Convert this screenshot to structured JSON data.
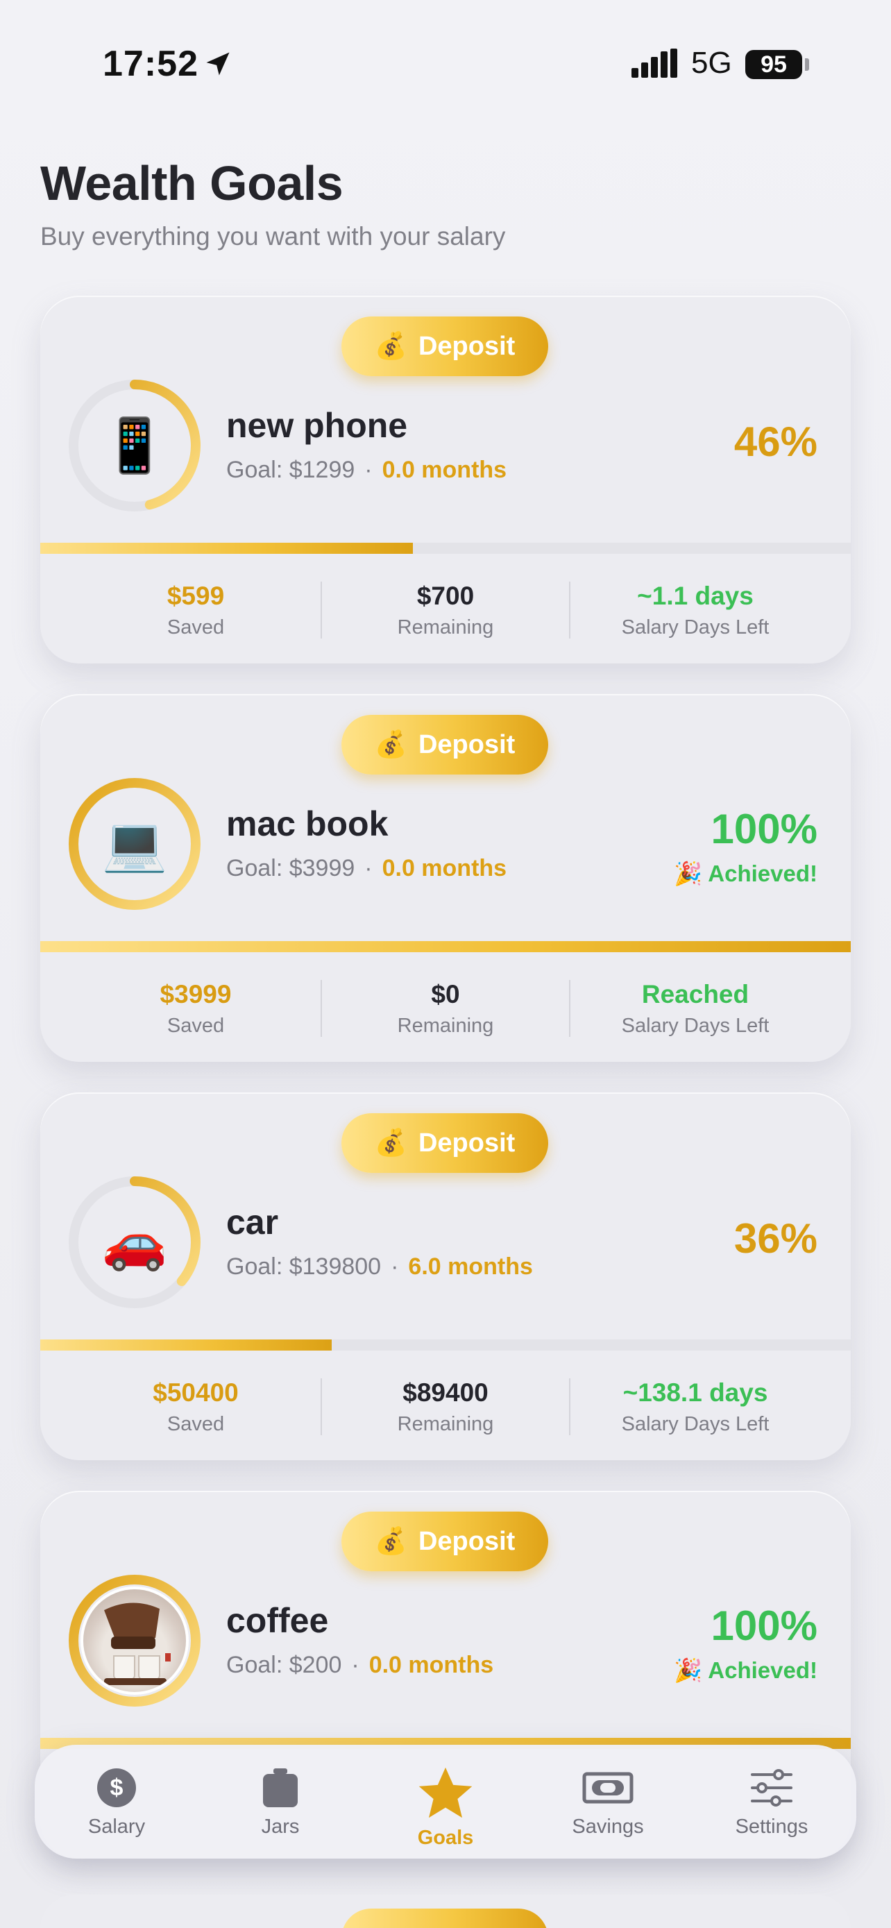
{
  "status_bar": {
    "time": "17:52",
    "network": "5G",
    "battery": "95"
  },
  "header": {
    "title": "Wealth Goals",
    "subtitle": "Buy everything you want with your salary"
  },
  "goals": [
    {
      "name": "new phone",
      "emoji": "📱",
      "deposit_label": "Deposit",
      "deposit_icon": "💰",
      "goal": "Goal: $1299",
      "months": "0.0 months",
      "percent": "46%",
      "progress": 0.46,
      "achieved": "",
      "saved": "$599",
      "saved_label": "Saved",
      "remaining": "$700",
      "remaining_label": "Remaining",
      "days": "~1.1 days",
      "days_label": "Salary Days Left"
    },
    {
      "name": "mac book",
      "emoji": "💻",
      "deposit_label": "Deposit",
      "deposit_icon": "💰",
      "goal": "Goal: $3999",
      "months": "0.0 months",
      "percent": "100%",
      "progress": 1.0,
      "achieved": "🎉 Achieved!",
      "saved": "$3999",
      "saved_label": "Saved",
      "remaining": "$0",
      "remaining_label": "Remaining",
      "days": "Reached",
      "days_label": "Salary Days Left"
    },
    {
      "name": "car",
      "emoji": "🚗",
      "deposit_label": "Deposit",
      "deposit_icon": "💰",
      "goal": "Goal: $139800",
      "months": "6.0 months",
      "percent": "36%",
      "progress": 0.36,
      "achieved": "",
      "saved": "$50400",
      "saved_label": "Saved",
      "remaining": "$89400",
      "remaining_label": "Remaining",
      "days": "~138.1 days",
      "days_label": "Salary Days Left"
    },
    {
      "name": "coffee",
      "emoji": "",
      "deposit_label": "Deposit",
      "deposit_icon": "💰",
      "goal": "Goal: $200",
      "months": "0.0 months",
      "percent": "100%",
      "progress": 1.0,
      "achieved": "🎉 Achieved!"
    }
  ],
  "tabs": [
    {
      "label": "Salary",
      "icon": "dollar-circle-icon"
    },
    {
      "label": "Jars",
      "icon": "jar-icon"
    },
    {
      "label": "Goals",
      "icon": "star-icon",
      "active": true
    },
    {
      "label": "Savings",
      "icon": "banknote-icon"
    },
    {
      "label": "Settings",
      "icon": "sliders-icon"
    }
  ],
  "colors": {
    "gold": "#dda014",
    "green": "#3bbf55",
    "gray": "#6e6e78"
  }
}
